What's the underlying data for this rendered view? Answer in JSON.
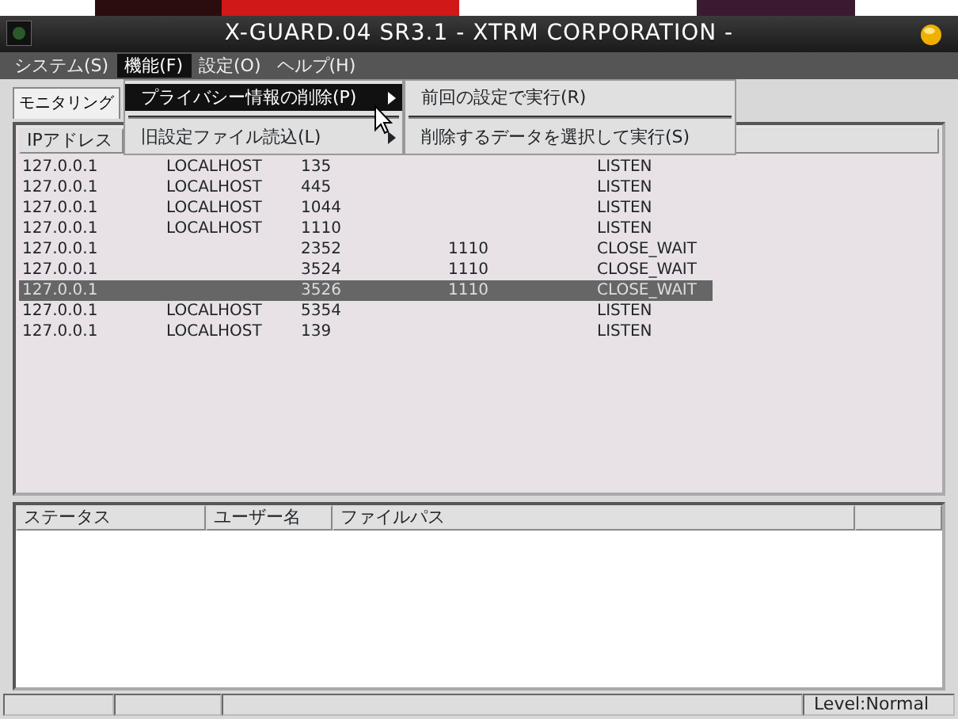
{
  "window": {
    "title": "X-GUARD.04 SR3.1 - XTRM CORPORATION -"
  },
  "menubar": [
    {
      "label": "システム(S)",
      "selected": false
    },
    {
      "label": "機能(F)",
      "selected": true
    },
    {
      "label": "設定(O)",
      "selected": false
    },
    {
      "label": "ヘルプ(H)",
      "selected": false
    }
  ],
  "open_menu": [
    {
      "kind": "item",
      "label": "プライバシー情報の削除(P)",
      "selected": true,
      "has_submenu": true
    },
    {
      "kind": "separator"
    },
    {
      "kind": "item",
      "label": "旧設定ファイル読込(L)",
      "selected": false,
      "has_submenu": true
    }
  ],
  "submenu": [
    {
      "kind": "item",
      "label": "前回の設定で実行(R)"
    },
    {
      "kind": "separator"
    },
    {
      "kind": "item",
      "label": "削除するデータを選択して実行(S)"
    }
  ],
  "tabs": [
    {
      "label": "モニタリング",
      "selected": true
    }
  ],
  "connections": {
    "columns": [
      "IPアドレス"
    ],
    "rows": [
      {
        "cells": [
          "127.0.0.1",
          "LOCALHOST",
          "135",
          null,
          "LISTEN"
        ],
        "selected": false
      },
      {
        "cells": [
          "127.0.0.1",
          "LOCALHOST",
          "445",
          null,
          "LISTEN"
        ],
        "selected": false
      },
      {
        "cells": [
          "127.0.0.1",
          "LOCALHOST",
          "1044",
          null,
          "LISTEN"
        ],
        "selected": false
      },
      {
        "cells": [
          "127.0.0.1",
          "LOCALHOST",
          "1110",
          null,
          "LISTEN"
        ],
        "selected": false
      },
      {
        "cells": [
          "127.0.0.1",
          null,
          "2352",
          "1110",
          "CLOSE_WAIT"
        ],
        "selected": false
      },
      {
        "cells": [
          "127.0.0.1",
          null,
          "3524",
          "1110",
          "CLOSE_WAIT"
        ],
        "selected": false
      },
      {
        "cells": [
          "127.0.0.1",
          null,
          "3526",
          "1110",
          "CLOSE_WAIT"
        ],
        "selected": true
      },
      {
        "cells": [
          "127.0.0.1",
          "LOCALHOST",
          "5354",
          null,
          "LISTEN"
        ],
        "selected": false
      },
      {
        "cells": [
          "127.0.0.1",
          "LOCALHOST",
          "139",
          null,
          "LISTEN"
        ],
        "selected": false
      }
    ]
  },
  "files": {
    "columns": [
      "ステータス",
      "ユーザー名",
      "ファイルパス"
    ]
  },
  "status_bar": {
    "level": "Level:Normal"
  }
}
